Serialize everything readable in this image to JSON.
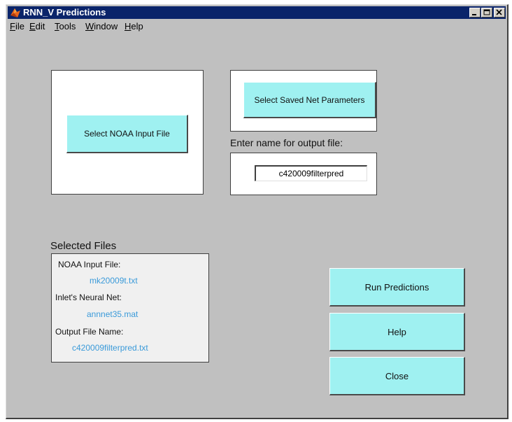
{
  "window": {
    "title": "RNN_V Predictions"
  },
  "menu": [
    {
      "label": "File",
      "mnemonic": "F",
      "rest": "ile"
    },
    {
      "label": "Edit",
      "mnemonic": "E",
      "rest": "dit"
    },
    {
      "label": "Tools",
      "mnemonic": "T",
      "rest": "ools"
    },
    {
      "label": "Window",
      "mnemonic": "W",
      "rest": "indow"
    },
    {
      "label": "Help",
      "mnemonic": "H",
      "rest": "elp"
    }
  ],
  "buttons": {
    "select_noaa": "Select NOAA Input File",
    "select_net": "Select Saved Net Parameters",
    "run": "Run Predictions",
    "help": "Help",
    "close": "Close"
  },
  "output": {
    "prompt": "Enter name for output file:",
    "value": "c420009filterpred"
  },
  "selected_files": {
    "heading": "Selected Files",
    "items": [
      {
        "label": "NOAA Input File:",
        "value": "mk20009t.txt"
      },
      {
        "label": "Inlet's Neural Net:",
        "value": "annnet35.mat"
      },
      {
        "label": "Output File Name:",
        "value": "c420009filterpred.txt"
      }
    ]
  },
  "colors": {
    "title_bar": "#0a246a",
    "button_face": "#9ff1f1",
    "window_bg": "#c0c0c0",
    "value_text": "#3a9ad9"
  },
  "icons": {
    "app": "matlab-logo-icon",
    "minimize": "minimize-icon",
    "maximize": "maximize-icon",
    "close": "close-icon"
  }
}
